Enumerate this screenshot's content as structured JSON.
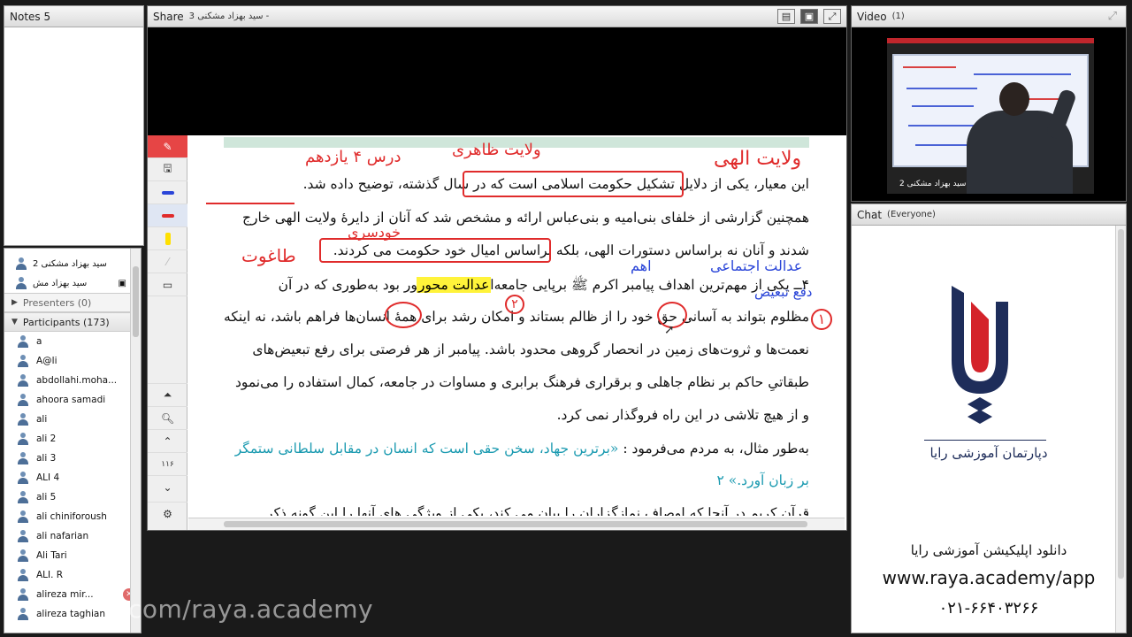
{
  "notes": {
    "title": "Notes 5"
  },
  "attendees": {
    "hosts": [
      "سید بهزاد مشکنی 2",
      "سید بهزاد مش"
    ],
    "presenters_label": "Presenters (0)",
    "participants_label": "Participants (173)",
    "participants": [
      "a",
      "A@li",
      "abdollahi.moha...",
      "ahoora samadi",
      "ali",
      "ali 2",
      "ali 3",
      "ALI 4",
      "ali 5",
      "ali chiniforoush",
      "ali nafarian",
      "Ali Tari",
      "ALI. R",
      "alireza mir...",
      "alireza taghian"
    ]
  },
  "share": {
    "title": "Share",
    "subtitle": "سید بهزاد مشکنی 3 -",
    "document_lines": [
      "این معیار، یکی از دلایل تشکیل حکومت اسلامی است که در سال گذشته، توضیح داده شد.",
      "همچنین گزارشی از خلفای بنی‌امیه و بنی‌عباس ارائه و مشخص شد که آنان از دایرهٔ ولایت الهی خارج",
      "شدند و آنان نه براساس دستورات الهی، بلکه براساس امیال خود حکومت می کردند.",
      "۴ــ یکی از مهم‌ترین اهداف پیامبر اکرم ﷺ برپایی جامعه‌ای عدالت محور بود به‌طوری که در آن",
      "مظلوم بتواند به آسانی حق خود را از ظالم بستاند و امکان رشد برای همهٔ انسان‌ها فراهم باشد، نه اینکه",
      "نعمت‌ها و ثروت‌های زمین در انحصار گروهی محدود باشد. پیامبر از هر فرصتی برای رفع تبعیض‌های",
      "طبقاتیِ حاکم بر نظام جاهلی و برقراری فرهنگ برابری و مساوات در جامعه، کمال استفاده را می‌نمود",
      "و از هیچ تلاشی در این راه فروگذار نمی کرد."
    ],
    "highlight": "عدالت محور",
    "quote_intro": "به‌طور مثال، به مردم می‌فرمود :",
    "quote_text": "«برترین جهاد، سخن حقی است که انسان در مقابل سلطانی ستمگر",
    "quote_text2": "بر زبان آورد.» ۲",
    "last_line": "قرآن کریم در آنجا که اوصاف نمازگزاران را بیان می کند، یکی از ویژگی های آنها را این گونه ذکر",
    "annotations": {
      "red_top_right": "ولایت الهی",
      "red_top_mid": "ولایت ظاهری",
      "red_top_left": "درس ۴ یازدهم",
      "red_left_1": "خودسری",
      "red_left_2": "طاغوت",
      "blue_right_1": "عدالت اجتماعی",
      "blue_right_2": "دفع تبعیض",
      "blue_mid": "اهم",
      "circle_1": "۱",
      "circle_2": "۲"
    },
    "watermark": "com/raya.academy"
  },
  "video": {
    "title": "Video",
    "count": "(1)",
    "caption": "سید بهزاد مشکنی 2"
  },
  "chat": {
    "title": "Chat",
    "scope": "(Everyone)",
    "logo_org": "دپارتمان آموزشی رایا",
    "download_text": "دانلود اپلیکیشن آموزشی رایا",
    "url": "www.raya.academy/app",
    "phone": "۰۲۱-۶۶۴۰۳۲۶۶"
  }
}
